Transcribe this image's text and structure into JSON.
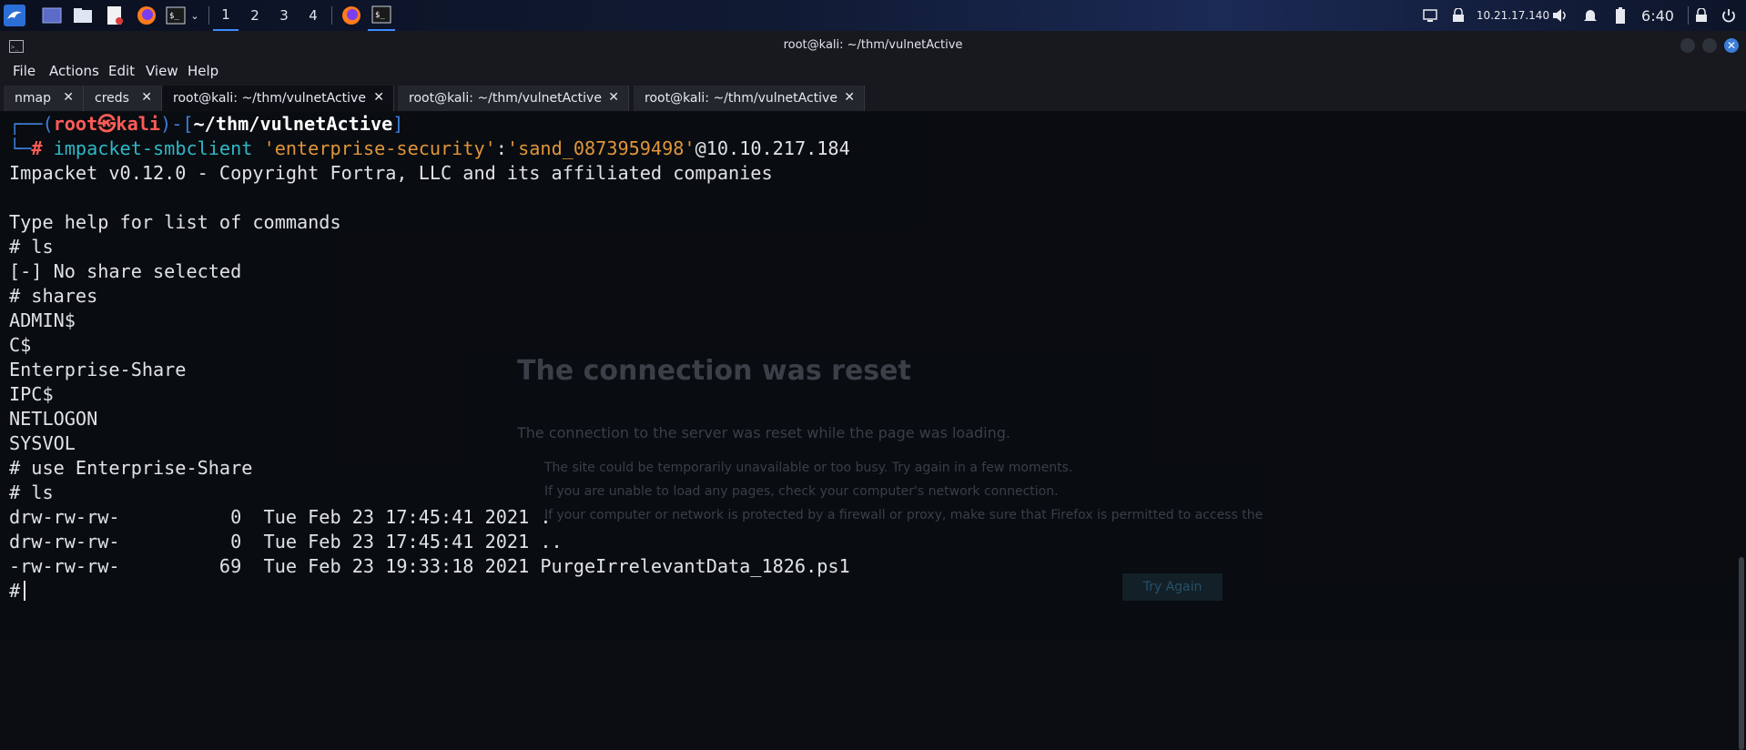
{
  "panel": {
    "workspaces": [
      "1",
      "2",
      "3",
      "4"
    ],
    "active_workspace": "1",
    "ip": "10.21.17.140",
    "time": "6:40",
    "icons": [
      "kali-menu-icon",
      "desktop-icon",
      "file-manager-icon",
      "text-editor-icon",
      "firefox-icon",
      "terminal-icon",
      "terminal-dropdown-icon",
      "firefox-window-icon",
      "terminal-window-icon",
      "display-icon",
      "vpn-lock-icon",
      "volume-icon",
      "bell-icon",
      "battery-icon",
      "lock-icon",
      "power-icon"
    ]
  },
  "window": {
    "title": "root@kali: ~/thm/vulnetActive"
  },
  "menu": [
    "File",
    "Actions",
    "Edit",
    "View",
    "Help"
  ],
  "tabs": [
    {
      "label": "nmap",
      "active": false
    },
    {
      "label": "creds",
      "active": false
    },
    {
      "label": "root@kali: ~/thm/vulnetActive",
      "active": true
    },
    {
      "label": "root@kali: ~/thm/vulnetActive",
      "active": false
    },
    {
      "label": "root@kali: ~/thm/vulnetActive",
      "active": false
    }
  ],
  "terminal": {
    "prompt": {
      "corner_top": "┌──(",
      "user": "root㉿kali",
      "mid": ")-[",
      "path": "~/thm/vulnetActive",
      "end": "]",
      "corner_bottom": "└─",
      "hash": "#"
    },
    "command": {
      "cmd": "impacket-smbclient",
      "arg1": "'enterprise-security'",
      "colon": ":",
      "arg2": "'sand_0873959498'",
      "host": "@10.10.217.184"
    },
    "output": [
      "Impacket v0.12.0 - Copyright Fortra, LLC and its affiliated companies",
      "",
      "Type help for list of commands",
      "# ls",
      "[-] No share selected",
      "# shares",
      "ADMIN$",
      "C$",
      "Enterprise-Share",
      "IPC$",
      "NETLOGON",
      "SYSVOL",
      "# use Enterprise-Share",
      "# ls",
      "drw-rw-rw-          0  Tue Feb 23 17:45:41 2021 .",
      "drw-rw-rw-          0  Tue Feb 23 17:45:41 2021 ..",
      "-rw-rw-rw-         69  Tue Feb 23 19:33:18 2021 PurgeIrrelevantData_1826.ps1"
    ],
    "final_prompt": "#"
  },
  "background_page": {
    "heading": "The connection was reset",
    "desc": "The connection to the server was reset while the page was loading.",
    "bullets": [
      "The site could be temporarily unavailable or too busy. Try again in a few moments.",
      "If you are unable to load any pages, check your computer's network connection.",
      "If your computer or network is protected by a firewall or proxy, make sure that Firefox is permitted to access the"
    ],
    "button": "Try Again"
  },
  "colors": {
    "prompt_blue": "#3d7dd8",
    "prompt_red": "#ff5c57",
    "command_cyan": "#2fb8c7",
    "string_orange": "#e0953a",
    "accent": "#3d8bff"
  }
}
